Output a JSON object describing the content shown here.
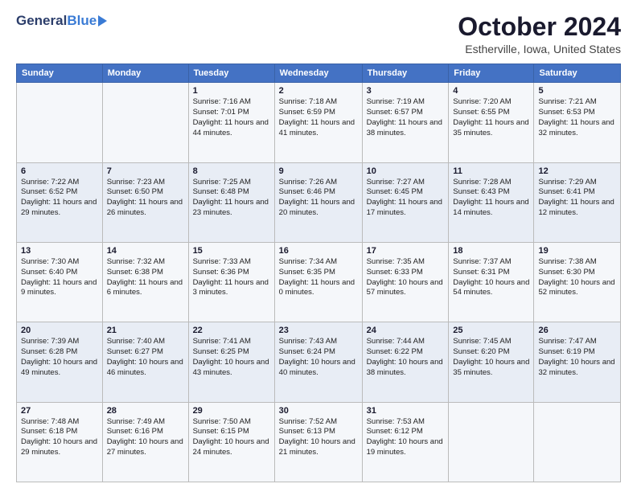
{
  "header": {
    "logo_general": "General",
    "logo_blue": "Blue",
    "month_title": "October 2024",
    "location": "Estherville, Iowa, United States"
  },
  "days_of_week": [
    "Sunday",
    "Monday",
    "Tuesday",
    "Wednesday",
    "Thursday",
    "Friday",
    "Saturday"
  ],
  "weeks": [
    [
      {
        "day": "",
        "sunrise": "",
        "sunset": "",
        "daylight": ""
      },
      {
        "day": "",
        "sunrise": "",
        "sunset": "",
        "daylight": ""
      },
      {
        "day": "1",
        "sunrise": "Sunrise: 7:16 AM",
        "sunset": "Sunset: 7:01 PM",
        "daylight": "Daylight: 11 hours and 44 minutes."
      },
      {
        "day": "2",
        "sunrise": "Sunrise: 7:18 AM",
        "sunset": "Sunset: 6:59 PM",
        "daylight": "Daylight: 11 hours and 41 minutes."
      },
      {
        "day": "3",
        "sunrise": "Sunrise: 7:19 AM",
        "sunset": "Sunset: 6:57 PM",
        "daylight": "Daylight: 11 hours and 38 minutes."
      },
      {
        "day": "4",
        "sunrise": "Sunrise: 7:20 AM",
        "sunset": "Sunset: 6:55 PM",
        "daylight": "Daylight: 11 hours and 35 minutes."
      },
      {
        "day": "5",
        "sunrise": "Sunrise: 7:21 AM",
        "sunset": "Sunset: 6:53 PM",
        "daylight": "Daylight: 11 hours and 32 minutes."
      }
    ],
    [
      {
        "day": "6",
        "sunrise": "Sunrise: 7:22 AM",
        "sunset": "Sunset: 6:52 PM",
        "daylight": "Daylight: 11 hours and 29 minutes."
      },
      {
        "day": "7",
        "sunrise": "Sunrise: 7:23 AM",
        "sunset": "Sunset: 6:50 PM",
        "daylight": "Daylight: 11 hours and 26 minutes."
      },
      {
        "day": "8",
        "sunrise": "Sunrise: 7:25 AM",
        "sunset": "Sunset: 6:48 PM",
        "daylight": "Daylight: 11 hours and 23 minutes."
      },
      {
        "day": "9",
        "sunrise": "Sunrise: 7:26 AM",
        "sunset": "Sunset: 6:46 PM",
        "daylight": "Daylight: 11 hours and 20 minutes."
      },
      {
        "day": "10",
        "sunrise": "Sunrise: 7:27 AM",
        "sunset": "Sunset: 6:45 PM",
        "daylight": "Daylight: 11 hours and 17 minutes."
      },
      {
        "day": "11",
        "sunrise": "Sunrise: 7:28 AM",
        "sunset": "Sunset: 6:43 PM",
        "daylight": "Daylight: 11 hours and 14 minutes."
      },
      {
        "day": "12",
        "sunrise": "Sunrise: 7:29 AM",
        "sunset": "Sunset: 6:41 PM",
        "daylight": "Daylight: 11 hours and 12 minutes."
      }
    ],
    [
      {
        "day": "13",
        "sunrise": "Sunrise: 7:30 AM",
        "sunset": "Sunset: 6:40 PM",
        "daylight": "Daylight: 11 hours and 9 minutes."
      },
      {
        "day": "14",
        "sunrise": "Sunrise: 7:32 AM",
        "sunset": "Sunset: 6:38 PM",
        "daylight": "Daylight: 11 hours and 6 minutes."
      },
      {
        "day": "15",
        "sunrise": "Sunrise: 7:33 AM",
        "sunset": "Sunset: 6:36 PM",
        "daylight": "Daylight: 11 hours and 3 minutes."
      },
      {
        "day": "16",
        "sunrise": "Sunrise: 7:34 AM",
        "sunset": "Sunset: 6:35 PM",
        "daylight": "Daylight: 11 hours and 0 minutes."
      },
      {
        "day": "17",
        "sunrise": "Sunrise: 7:35 AM",
        "sunset": "Sunset: 6:33 PM",
        "daylight": "Daylight: 10 hours and 57 minutes."
      },
      {
        "day": "18",
        "sunrise": "Sunrise: 7:37 AM",
        "sunset": "Sunset: 6:31 PM",
        "daylight": "Daylight: 10 hours and 54 minutes."
      },
      {
        "day": "19",
        "sunrise": "Sunrise: 7:38 AM",
        "sunset": "Sunset: 6:30 PM",
        "daylight": "Daylight: 10 hours and 52 minutes."
      }
    ],
    [
      {
        "day": "20",
        "sunrise": "Sunrise: 7:39 AM",
        "sunset": "Sunset: 6:28 PM",
        "daylight": "Daylight: 10 hours and 49 minutes."
      },
      {
        "day": "21",
        "sunrise": "Sunrise: 7:40 AM",
        "sunset": "Sunset: 6:27 PM",
        "daylight": "Daylight: 10 hours and 46 minutes."
      },
      {
        "day": "22",
        "sunrise": "Sunrise: 7:41 AM",
        "sunset": "Sunset: 6:25 PM",
        "daylight": "Daylight: 10 hours and 43 minutes."
      },
      {
        "day": "23",
        "sunrise": "Sunrise: 7:43 AM",
        "sunset": "Sunset: 6:24 PM",
        "daylight": "Daylight: 10 hours and 40 minutes."
      },
      {
        "day": "24",
        "sunrise": "Sunrise: 7:44 AM",
        "sunset": "Sunset: 6:22 PM",
        "daylight": "Daylight: 10 hours and 38 minutes."
      },
      {
        "day": "25",
        "sunrise": "Sunrise: 7:45 AM",
        "sunset": "Sunset: 6:20 PM",
        "daylight": "Daylight: 10 hours and 35 minutes."
      },
      {
        "day": "26",
        "sunrise": "Sunrise: 7:47 AM",
        "sunset": "Sunset: 6:19 PM",
        "daylight": "Daylight: 10 hours and 32 minutes."
      }
    ],
    [
      {
        "day": "27",
        "sunrise": "Sunrise: 7:48 AM",
        "sunset": "Sunset: 6:18 PM",
        "daylight": "Daylight: 10 hours and 29 minutes."
      },
      {
        "day": "28",
        "sunrise": "Sunrise: 7:49 AM",
        "sunset": "Sunset: 6:16 PM",
        "daylight": "Daylight: 10 hours and 27 minutes."
      },
      {
        "day": "29",
        "sunrise": "Sunrise: 7:50 AM",
        "sunset": "Sunset: 6:15 PM",
        "daylight": "Daylight: 10 hours and 24 minutes."
      },
      {
        "day": "30",
        "sunrise": "Sunrise: 7:52 AM",
        "sunset": "Sunset: 6:13 PM",
        "daylight": "Daylight: 10 hours and 21 minutes."
      },
      {
        "day": "31",
        "sunrise": "Sunrise: 7:53 AM",
        "sunset": "Sunset: 6:12 PM",
        "daylight": "Daylight: 10 hours and 19 minutes."
      },
      {
        "day": "",
        "sunrise": "",
        "sunset": "",
        "daylight": ""
      },
      {
        "day": "",
        "sunrise": "",
        "sunset": "",
        "daylight": ""
      }
    ]
  ]
}
